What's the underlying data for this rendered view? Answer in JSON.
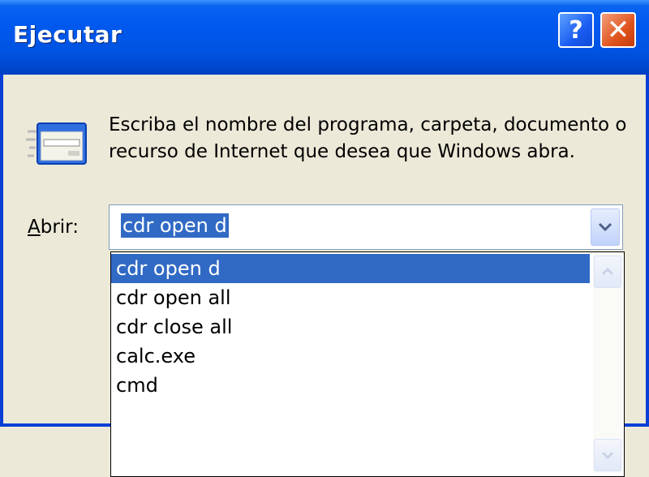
{
  "window": {
    "title": "Ejecutar",
    "help_label": "?",
    "close_label": "✕"
  },
  "dialog": {
    "description_line1": "Escriba el nombre del programa, carpeta, documento o",
    "description_line2": "recurso de Internet que desea que Windows abra.",
    "open_label_accel": "A",
    "open_label_rest": "brir:",
    "input_value": "cdr open d"
  },
  "history": {
    "items": [
      "cdr open d",
      "cdr open all",
      "cdr close all",
      "calc.exe",
      "cmd"
    ],
    "selected_index": 0
  },
  "icons": {
    "run": "run-program-icon",
    "dropdown": "chevron-down-icon",
    "scroll_up": "scroll-up-arrow-icon",
    "scroll_down": "scroll-down-arrow-icon"
  },
  "colors": {
    "title_bar": "#0058ee",
    "selection": "#316ac5",
    "close_button": "#e0531d",
    "dialog_bg": "#ece9d8"
  }
}
